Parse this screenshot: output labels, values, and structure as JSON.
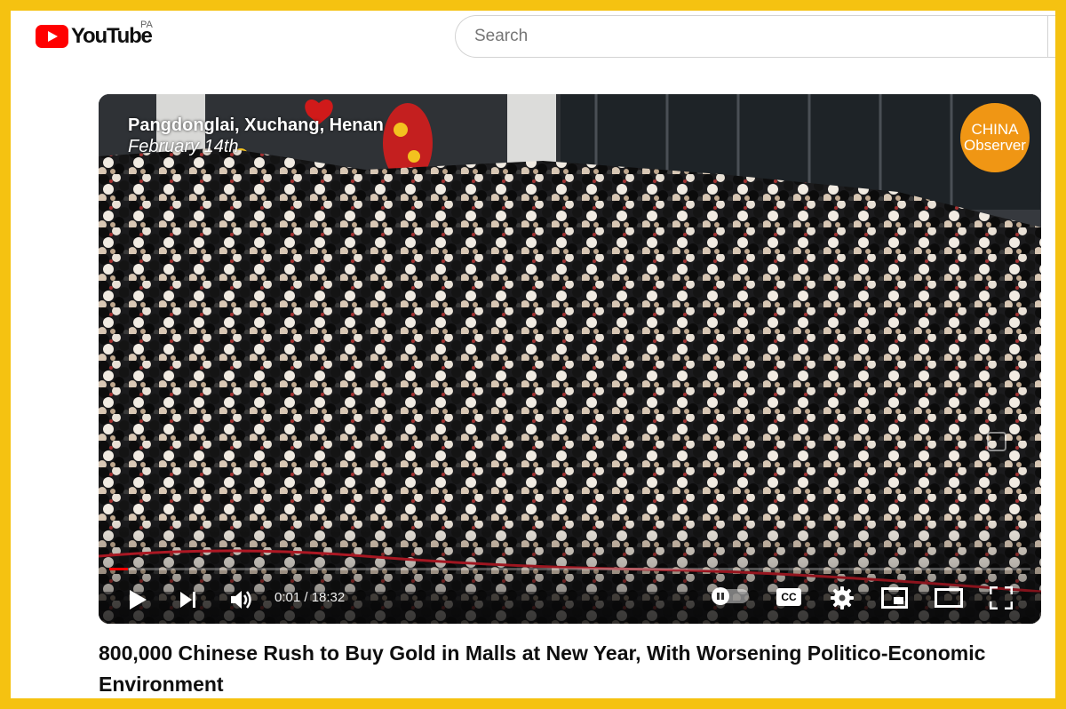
{
  "header": {
    "logo_text": "YouTube",
    "country_code": "PA",
    "search": {
      "placeholder": "Search"
    }
  },
  "video": {
    "overlay": {
      "location": "Pangdonglai, Xuchang, Henan",
      "date": "February 14th"
    },
    "channel_watermark": {
      "line1": "CHINA",
      "line2": "Observer"
    },
    "player": {
      "current_time": "0:01",
      "duration": "18:32",
      "time_display": "0:01 / 18:32",
      "progress_fraction": 0.001,
      "cc_label": "CC",
      "controls": [
        "play-icon",
        "next-icon",
        "volume-icon",
        "autoplay-toggle",
        "cc-icon",
        "settings-icon",
        "miniplayer-icon",
        "theater-icon",
        "fullscreen-icon"
      ]
    },
    "title": "800,000 Chinese Rush to Buy Gold in Malls at New Year, With Worsening Politico-Economic Environment"
  },
  "colors": {
    "frame_border": "#f5c211",
    "brand_red": "#ff0000",
    "progress": "#ff0000",
    "channel_logo": "#f09614"
  }
}
